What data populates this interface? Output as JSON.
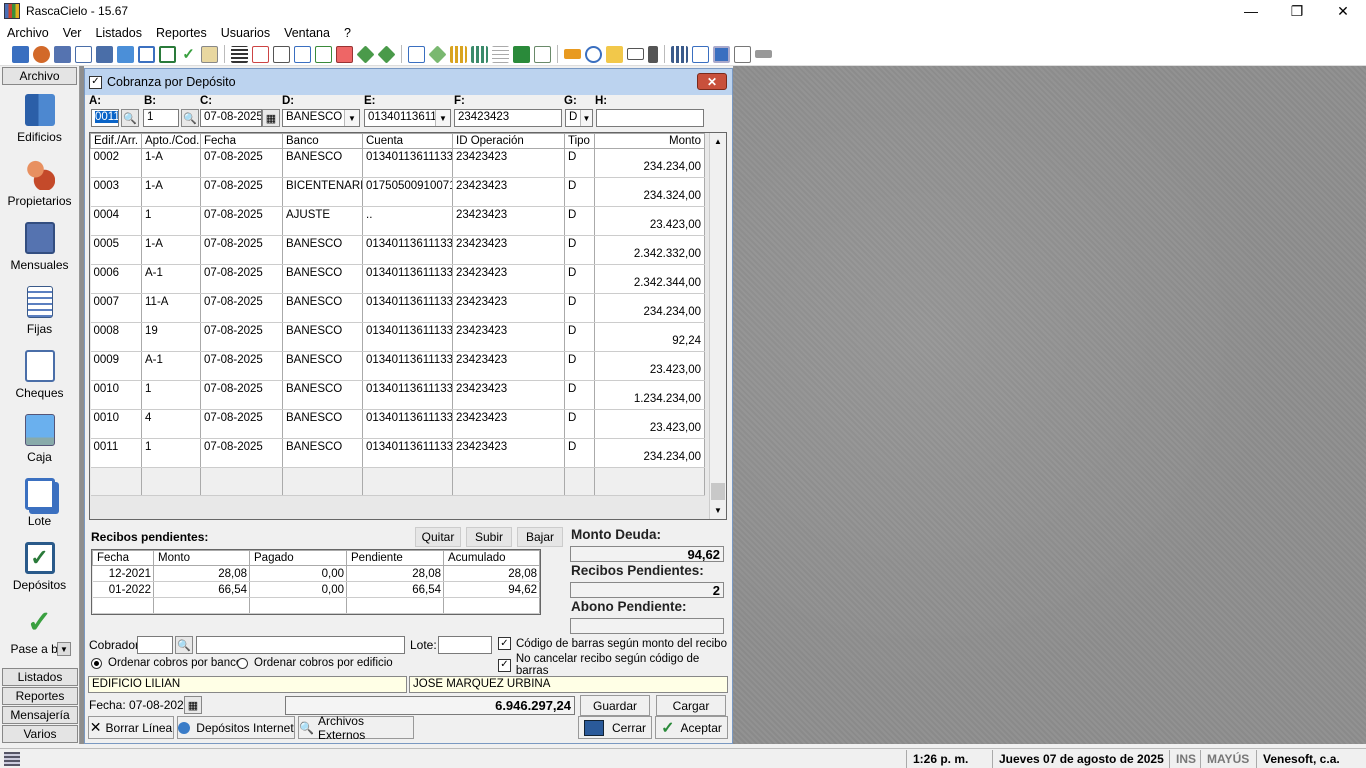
{
  "app": {
    "title": "RascaCielo - 15.67"
  },
  "window_controls": {
    "minimize": "—",
    "maximize": "❐",
    "close": "✕"
  },
  "menu": [
    "Archivo",
    "Ver",
    "Listados",
    "Reportes",
    "Usuarios",
    "Ventana",
    "?"
  ],
  "sidebar": {
    "header": "Archivo",
    "items": [
      {
        "label": "Edificios",
        "icon": "buildings-icon",
        "color": "#3a7cc8"
      },
      {
        "label": "Propietarios",
        "icon": "owners-icon",
        "color": "#d2692a"
      },
      {
        "label": "Mensuales",
        "icon": "monthly-book-icon",
        "color": "#5573b0"
      },
      {
        "label": "Fijas",
        "icon": "document-icon",
        "color": "#5b7fc0"
      },
      {
        "label": "Cheques",
        "icon": "check-pen-icon",
        "color": "#4a6ea8"
      },
      {
        "label": "Caja",
        "icon": "monitor-icon",
        "color": "#4b8fd8"
      },
      {
        "label": "Lote",
        "icon": "windows-stack-icon",
        "color": "#3b70c0"
      },
      {
        "label": "Depósitos",
        "icon": "checkbox-icon",
        "color": "#2a7a3a"
      },
      {
        "label": "Pase a bar",
        "icon": "checkmark-icon",
        "color": "#3aa040"
      }
    ],
    "bottom": [
      "Listados",
      "Reportes",
      "Mensajería",
      "Varios"
    ]
  },
  "dialog": {
    "title": "Cobranza por Depósito",
    "close": "✕",
    "field_labels": {
      "a": "A:",
      "b": "B:",
      "c": "C:",
      "d": "D:",
      "e": "E:",
      "f": "F:",
      "g": "G:",
      "h": "H:"
    },
    "fields": {
      "a": "0011",
      "b": "1",
      "c": "07-08-2025",
      "d": "BANESCO",
      "e": "01340113611",
      "f": "23423423",
      "g": "D",
      "h": ""
    },
    "grid": {
      "columns": [
        "Edif./Arr.",
        "Apto./Cod.",
        "Fecha",
        "Banco",
        "Cuenta",
        "ID Operación",
        "Tipo",
        "Monto"
      ],
      "rows": [
        [
          "0002",
          "1-A",
          "07-08-2025",
          "BANESCO",
          "01340113611133",
          "23423423",
          "D",
          "234.234,00"
        ],
        [
          "0003",
          "1-A",
          "07-08-2025",
          "BICENTENARIO",
          "01750500910071",
          "23423423",
          "D",
          "234.324,00"
        ],
        [
          "0004",
          "1",
          "07-08-2025",
          "AJUSTE",
          "..",
          "23423423",
          "D",
          "23.423,00"
        ],
        [
          "0005",
          "1-A",
          "07-08-2025",
          "BANESCO",
          "01340113611133",
          "23423423",
          "D",
          "2.342.332,00"
        ],
        [
          "0006",
          "A-1",
          "07-08-2025",
          "BANESCO",
          "01340113611133",
          "23423423",
          "D",
          "2.342.344,00"
        ],
        [
          "0007",
          "11-A",
          "07-08-2025",
          "BANESCO",
          "01340113611133",
          "23423423",
          "D",
          "234.234,00"
        ],
        [
          "0008",
          "19",
          "07-08-2025",
          "BANESCO",
          "01340113611133",
          "23423423",
          "D",
          "92,24"
        ],
        [
          "0009",
          "A-1",
          "07-08-2025",
          "BANESCO",
          "01340113611133",
          "23423423",
          "D",
          "23.423,00"
        ],
        [
          "0010",
          "1",
          "07-08-2025",
          "BANESCO",
          "01340113611133",
          "23423423",
          "D",
          "1.234.234,00"
        ],
        [
          "0010",
          "4",
          "07-08-2025",
          "BANESCO",
          "01340113611133",
          "23423423",
          "D",
          "23.423,00"
        ],
        [
          "0011",
          "1",
          "07-08-2025",
          "BANESCO",
          "01340113611133",
          "23423423",
          "D",
          "234.234,00"
        ]
      ]
    },
    "pending": {
      "title": "Recibos pendientes:",
      "buttons": [
        "Quitar",
        "Subir",
        "Bajar"
      ],
      "columns": [
        "Fecha",
        "Monto",
        "Pagado",
        "Pendiente",
        "Acumulado"
      ],
      "rows": [
        [
          "12-2021",
          "28,08",
          "0,00",
          "28,08",
          "28,08"
        ],
        [
          "01-2022",
          "66,54",
          "0,00",
          "66,54",
          "94,62"
        ]
      ]
    },
    "summary": {
      "monto_deuda_label": "Monto Deuda:",
      "monto_deuda": "94,62",
      "recibos_label": "Recibos Pendientes:",
      "recibos": "2",
      "abono_label": "Abono Pendiente:",
      "abono": ""
    },
    "options": {
      "cobrador_label": "Cobrador:",
      "lote_label": "Lote:",
      "barcode_monto": "Código de barras según monto del recibo",
      "no_cancel": "No cancelar recibo según código de barras",
      "order_bank": "Ordenar cobros por banco",
      "order_building": "Ordenar cobros por edificio"
    },
    "info": {
      "building": "EDIFICIO LILIAN",
      "owner": "JOSE MARQUEZ URBINA",
      "date_label": "Fecha: 07-08-2025",
      "total": "6.946.297,24"
    },
    "buttons": {
      "guardar": "Guardar",
      "cargar": "Cargar",
      "borrar": "Borrar Línea",
      "depositos": "Depósitos Internet",
      "archivos": "Archivos Externos",
      "cerrar": "Cerrar",
      "aceptar": "Aceptar"
    }
  },
  "statusbar": {
    "time": "1:26 p. m.",
    "date": "Jueves 07 de agosto de 2025",
    "ins": "INS",
    "caps": "MAYÚS",
    "company": "Venesoft, c.a."
  }
}
